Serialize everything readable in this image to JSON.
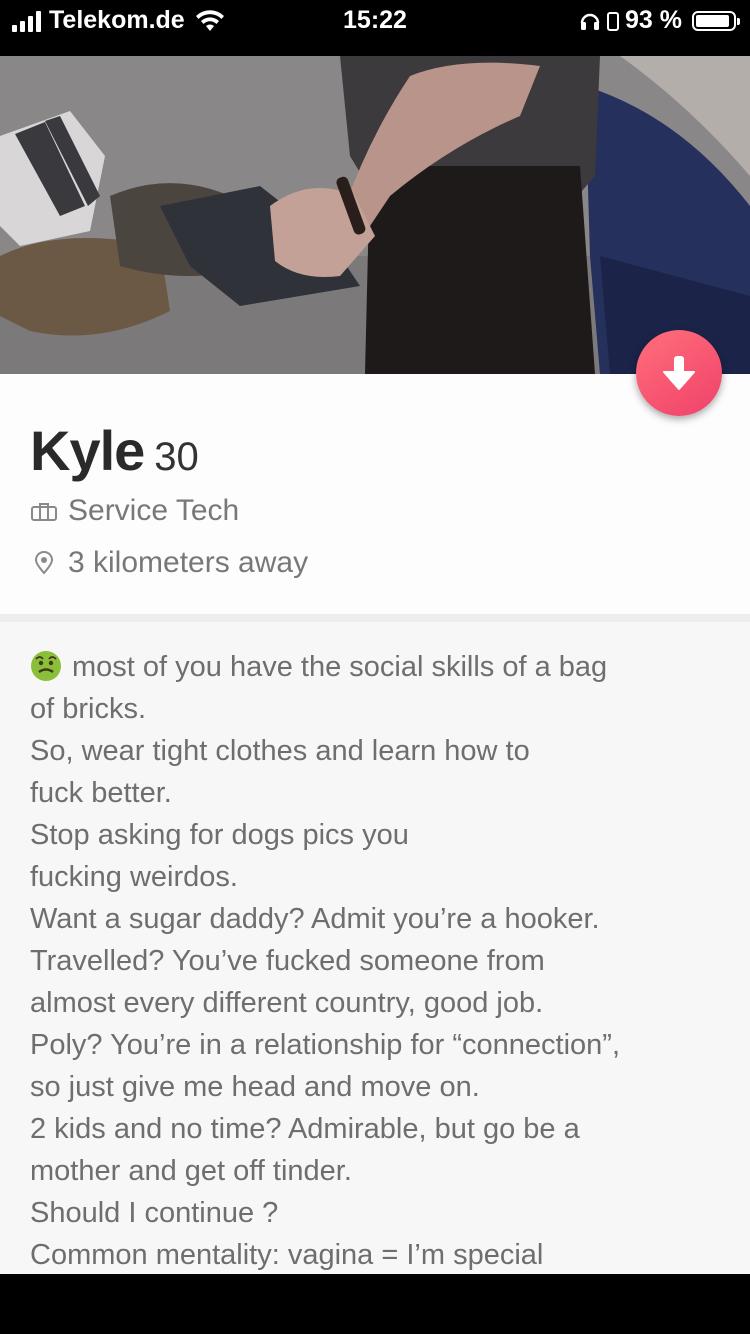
{
  "status_bar": {
    "carrier": "Telekom.de",
    "time": "15:22",
    "battery_percent": "93 %",
    "battery_level": 0.93
  },
  "photo": {
    "description_icon": "profile-photo"
  },
  "profile": {
    "name": "Kyle",
    "age": "30",
    "job": "Service Tech",
    "distance": "3 kilometers away"
  },
  "actions": {
    "nope_icon": "arrow-down-icon",
    "nope_color": "#f0416a"
  },
  "bio": {
    "lines": [
      "most of you have the social skills of a bag",
      "of bricks.",
      "So, wear tight clothes and learn how to",
      "fuck better.",
      "Stop asking for dogs pics you",
      "fucking weirdos.",
      "Want a sugar daddy? Admit you’re a hooker.",
      "Travelled? You’ve fucked someone from",
      "almost every different country, good job.",
      "Poly? You’re in a relationship for “connection”,",
      "so just give me head and move on.",
      "2 kids and no time? Admirable, but go be a",
      "mother and get off tinder.",
      "Should I continue ?",
      "Common mentality: vagina =  I’m special"
    ]
  }
}
